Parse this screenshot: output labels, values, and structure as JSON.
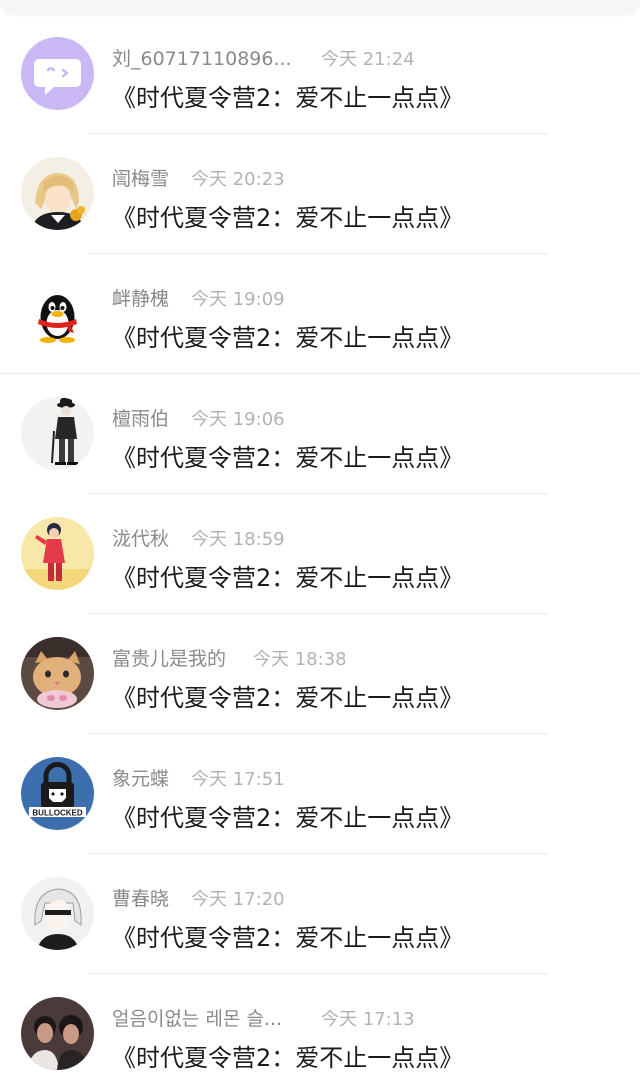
{
  "comments": [
    {
      "name": "刘_60717110896...",
      "time": "今天 21:24",
      "message": "《时代夏令营2：爱不止一点点》",
      "avatar": "chat-bubble-icon"
    },
    {
      "name": "訚梅雪",
      "time": "今天 20:23",
      "message": "《时代夏令营2：爱不止一点点》",
      "avatar": "anime-boy-avatar"
    },
    {
      "name": "衅静槐",
      "time": "今天 19:09",
      "message": "《时代夏令营2：爱不止一点点》",
      "avatar": "qq-penguin-icon"
    },
    {
      "name": "檀雨伯",
      "time": "今天 19:06",
      "message": "《时代夏令营2：爱不止一点点》",
      "avatar": "chaplin-avatar"
    },
    {
      "name": "泷代秋",
      "time": "今天 18:59",
      "message": "《时代夏令营2：爱不止一点点》",
      "avatar": "red-shirt-person-avatar"
    },
    {
      "name": "富贵儿是我的",
      "time": "今天 18:38",
      "message": "《时代夏令营2：爱不止一点点》",
      "avatar": "cat-avatar"
    },
    {
      "name": "象元蝶",
      "time": "今天 17:51",
      "message": "《时代夏令营2：爱不止一点点》",
      "avatar": "bullocked-logo-avatar"
    },
    {
      "name": "曹春晓",
      "time": "今天 17:20",
      "message": "《时代夏令营2：爱不止一点点》",
      "avatar": "anime-girl-avatar"
    },
    {
      "name": "얼음이없는 레몬 슬...",
      "time": "今天 17:13",
      "message": "《时代夏令营2：爱不止一点点》",
      "avatar": "two-people-avatar"
    }
  ],
  "colors": {
    "name": "#8a8a8a",
    "time": "#b3b3b3",
    "message": "#1c1c1c",
    "divider": "#efefef",
    "chat_avatar_bg": "#c7b6f2"
  },
  "logo_text": "BULLOCKED"
}
